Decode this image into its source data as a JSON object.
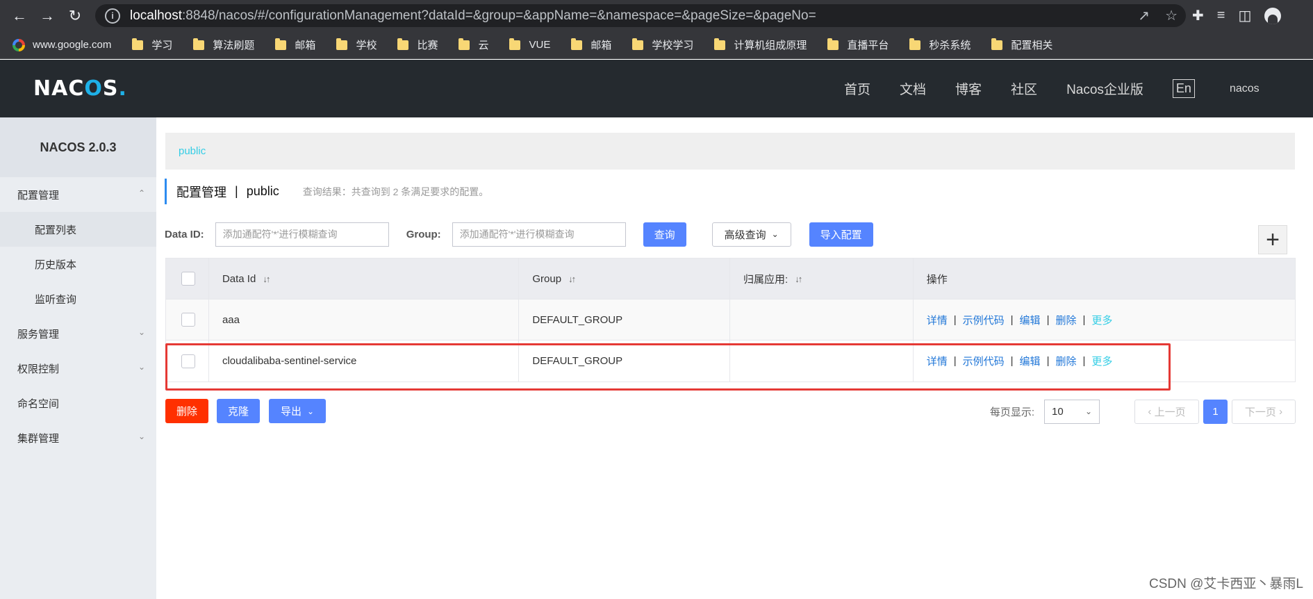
{
  "browser": {
    "url_host": "localhost",
    "url_rest": ":8848/nacos/#/configurationManagement?dataId=&group=&appName=&namespace=&pageSize=&pageNo=",
    "bookmarks": [
      {
        "label": "www.google.com",
        "icon": "google-icon"
      },
      {
        "label": "学习",
        "icon": "folder-icon"
      },
      {
        "label": "算法刷题",
        "icon": "folder-icon"
      },
      {
        "label": "邮箱",
        "icon": "folder-icon"
      },
      {
        "label": "学校",
        "icon": "folder-icon"
      },
      {
        "label": "比赛",
        "icon": "folder-icon"
      },
      {
        "label": "云",
        "icon": "folder-icon"
      },
      {
        "label": "VUE",
        "icon": "folder-icon"
      },
      {
        "label": "邮箱",
        "icon": "folder-icon"
      },
      {
        "label": "学校学习",
        "icon": "folder-icon"
      },
      {
        "label": "计算机组成原理",
        "icon": "folder-icon"
      },
      {
        "label": "直播平台",
        "icon": "folder-icon"
      },
      {
        "label": "秒杀系统",
        "icon": "folder-icon"
      },
      {
        "label": "配置相关",
        "icon": "folder-icon"
      }
    ]
  },
  "header": {
    "logo": "NACOS.",
    "nav": [
      "首页",
      "文档",
      "博客",
      "社区",
      "Nacos企业版"
    ],
    "lang": "En",
    "user": "nacos"
  },
  "sidebar": {
    "title": "NACOS 2.0.3",
    "items": [
      {
        "label": "配置管理",
        "expanded": true
      },
      {
        "label": "配置列表",
        "sub": true,
        "active": true
      },
      {
        "label": "历史版本",
        "sub": true
      },
      {
        "label": "监听查询",
        "sub": true
      },
      {
        "label": "服务管理"
      },
      {
        "label": "权限控制"
      },
      {
        "label": "命名空间"
      },
      {
        "label": "集群管理"
      }
    ]
  },
  "main": {
    "namespace_tab": "public",
    "title": "配置管理",
    "title_sep": "|",
    "title_ns": "public",
    "result_hint": "查询结果：共查询到 2 条满足要求的配置。",
    "filters": {
      "data_id_label": "Data ID:",
      "data_id_placeholder": "添加通配符'*'进行模糊查询",
      "group_label": "Group:",
      "group_placeholder": "添加通配符'*'进行模糊查询",
      "search_btn": "查询",
      "advanced_btn": "高级查询",
      "import_btn": "导入配置"
    },
    "table": {
      "headers": [
        "Data Id",
        "Group",
        "归属应用:",
        "操作"
      ],
      "rows": [
        {
          "data_id": "aaa",
          "group": "DEFAULT_GROUP",
          "app": ""
        },
        {
          "data_id": "cloudalibaba-sentinel-service",
          "group": "DEFAULT_GROUP",
          "app": ""
        }
      ],
      "ops": [
        "详情",
        "示例代码",
        "编辑",
        "删除",
        "更多"
      ]
    },
    "bottom": {
      "delete_btn": "删除",
      "clone_btn": "克隆",
      "export_btn": "导出",
      "page_size_label": "每页显示:",
      "page_size": "10",
      "prev": "上一页",
      "current_page": "1",
      "next": "下一页"
    }
  },
  "watermark": "CSDN @艾卡西亚丶暴雨L",
  "colors": {
    "primary": "#5584ff",
    "danger": "#ff3000",
    "header_bg": "#252a2f",
    "link": "#2177d8",
    "highlight": "#e53935"
  }
}
